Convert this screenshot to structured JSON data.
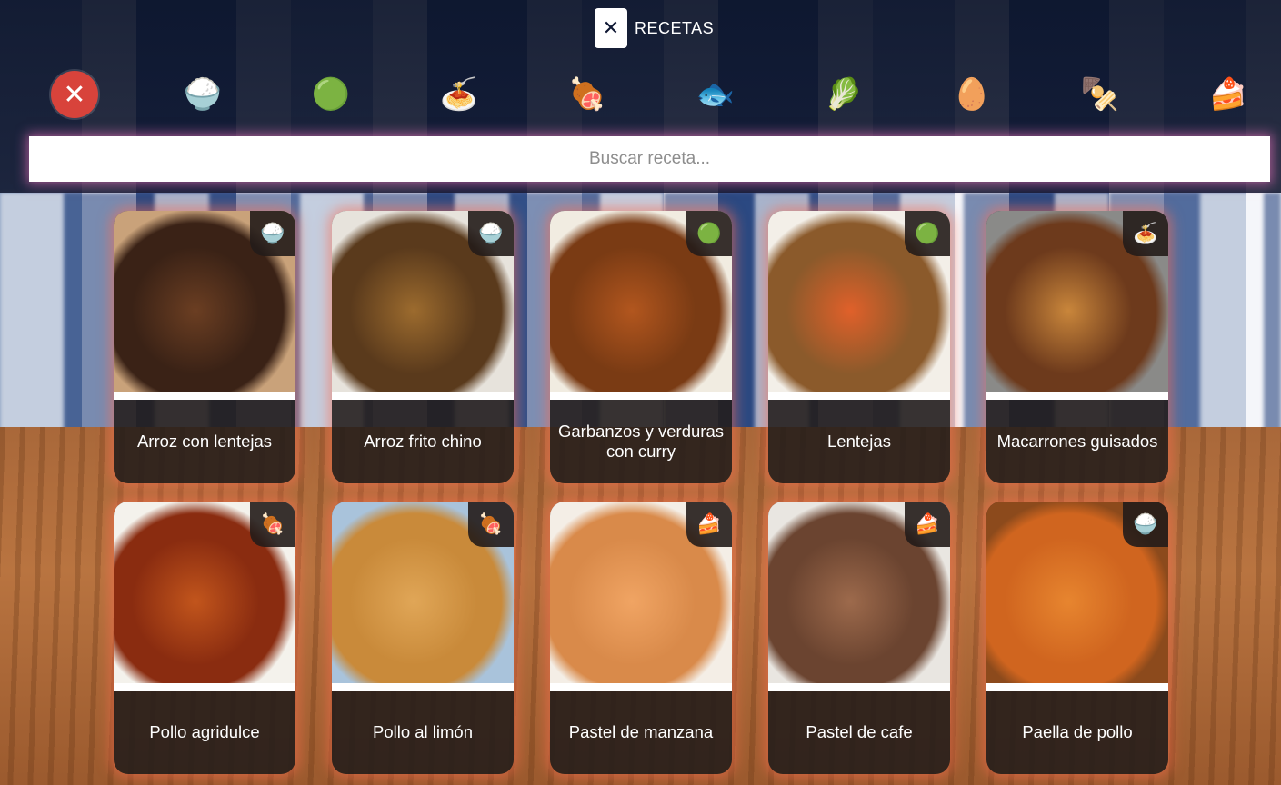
{
  "header": {
    "title": "RECETAS",
    "logo_glyph": "✕"
  },
  "categories": [
    {
      "name": "clear-filter",
      "glyph": "✕",
      "label": ""
    },
    {
      "name": "rice",
      "glyph": "🍚",
      "label": ""
    },
    {
      "name": "legumes",
      "glyph": "🟢",
      "label": ""
    },
    {
      "name": "pasta",
      "glyph": "🍝",
      "label": ""
    },
    {
      "name": "meat",
      "glyph": "🍖",
      "label": ""
    },
    {
      "name": "fish",
      "glyph": "🐟",
      "label": ""
    },
    {
      "name": "vegetables",
      "glyph": "🥬",
      "label": ""
    },
    {
      "name": "eggs",
      "glyph": "🥚",
      "label": ""
    },
    {
      "name": "tapas",
      "glyph": "🍢",
      "label": ""
    },
    {
      "name": "dessert",
      "glyph": "🍰",
      "label": ""
    }
  ],
  "search": {
    "placeholder": "Buscar receta..."
  },
  "recipes": [
    {
      "title": "Arroz con lentejas",
      "badge": "🍚",
      "colors": [
        "#3a2216",
        "#6b3e22",
        "#c9a27a"
      ]
    },
    {
      "title": "Arroz frito chino",
      "badge": "🍚",
      "colors": [
        "#5a3a1c",
        "#9c6b2e",
        "#e7e3dc"
      ]
    },
    {
      "title": "Garbanzos y verduras con curry",
      "badge": "🟢",
      "colors": [
        "#7a3b14",
        "#b2561e",
        "#f1ece1"
      ]
    },
    {
      "title": "Lentejas",
      "badge": "🟢",
      "colors": [
        "#8b5a2b",
        "#e0602a",
        "#f3efe8"
      ]
    },
    {
      "title": "Macarrones guisados",
      "badge": "🍝",
      "colors": [
        "#6d3a1c",
        "#c9863b",
        "#8a8a88"
      ]
    },
    {
      "title": "Pollo agridulce",
      "badge": "🍖",
      "colors": [
        "#8a2c10",
        "#c2551c",
        "#f4f2ec"
      ]
    },
    {
      "title": "Pollo al limón",
      "badge": "🍖",
      "colors": [
        "#c98a3a",
        "#e0a657",
        "#a9c3db"
      ]
    },
    {
      "title": "Pastel de manzana",
      "badge": "🍰",
      "colors": [
        "#d98a4a",
        "#f0a463",
        "#f4eee6"
      ]
    },
    {
      "title": "Pastel de cafe",
      "badge": "🍰",
      "colors": [
        "#6b4430",
        "#9d6a4c",
        "#e9e6e1"
      ]
    },
    {
      "title": "Paella de pollo",
      "badge": "🍚",
      "colors": [
        "#d0651f",
        "#e7852f",
        "#8c4a1c"
      ]
    }
  ]
}
